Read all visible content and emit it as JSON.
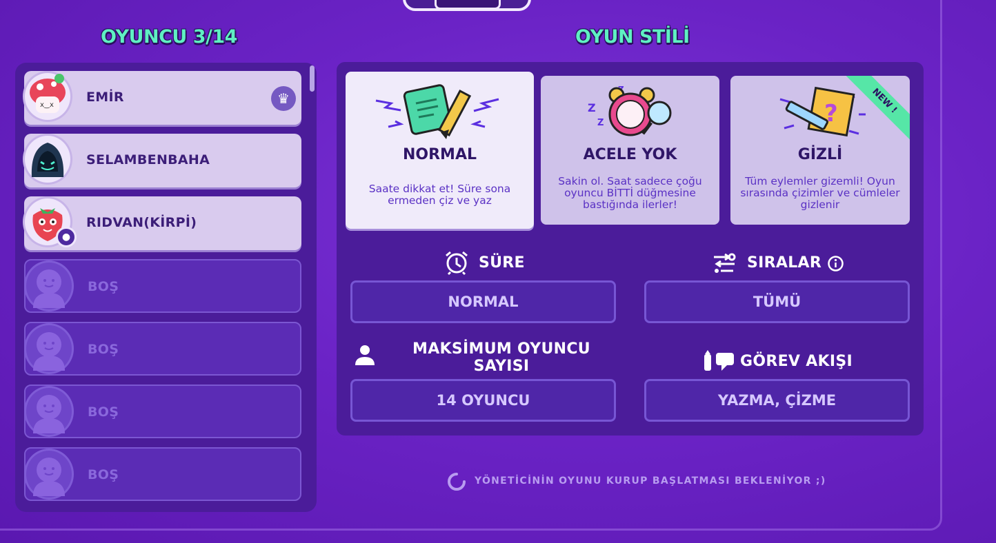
{
  "players_section": {
    "title": "OYUNCU 3/14",
    "players": [
      {
        "name": "EMİR",
        "status": "filled",
        "badge": "crown-icon"
      },
      {
        "name": "SELAMBENBAHA",
        "status": "filled",
        "badge": ""
      },
      {
        "name": "RIDVAN(KİRPİ)",
        "status": "filled",
        "badge": "user-icon"
      },
      {
        "name": "BOŞ",
        "status": "empty",
        "badge": ""
      },
      {
        "name": "BOŞ",
        "status": "empty",
        "badge": ""
      },
      {
        "name": "BOŞ",
        "status": "empty",
        "badge": ""
      },
      {
        "name": "BOŞ",
        "status": "empty",
        "badge": ""
      }
    ]
  },
  "game_style": {
    "title": "OYUN STİLİ",
    "modes": [
      {
        "title": "NORMAL",
        "desc": "Saate dikkat et! Süre sona ermeden çiz ve yaz",
        "selected": true,
        "icon": "notebook-pencil-icon"
      },
      {
        "title": "ACELE YOK",
        "desc": "Sakin ol. Saat sadece çoğu oyuncu BİTTİ düğmesine bastığında ilerler!",
        "selected": false,
        "icon": "alarm-clock-icon"
      },
      {
        "title": "GİZLİ",
        "desc": "Tüm eylemler gizemli! Oyun sırasında çizimler ve cümleler gizlenir",
        "selected": false,
        "icon": "secret-pencil-icon",
        "ribbon": "NEW !"
      }
    ]
  },
  "settings": {
    "time": {
      "label": "SÜRE",
      "value": "NORMAL",
      "icon": "alarm-icon"
    },
    "order": {
      "label": "SIRALAR",
      "value": "TÜMÜ",
      "icon": "shuffle-icon"
    },
    "max_players": {
      "label": "MAKSİMUM OYUNCU SAYISI",
      "value": "14 OYUNCU",
      "icon": "person-icon"
    },
    "task_flow": {
      "label": "GÖREV AKIŞI",
      "value": "YAZMA, ÇİZME",
      "icon": "pen-chat-icon"
    }
  },
  "status": {
    "waiting_text": "YÖNETİCİNİN OYUNU KURUP BAŞLATMASI BEKLENİYOR ;)"
  },
  "colors": {
    "accent_title": "#5ff0c3",
    "panel": "#4b1c9a",
    "background": "#6b23c6",
    "ribbon": "#56e6a7"
  }
}
